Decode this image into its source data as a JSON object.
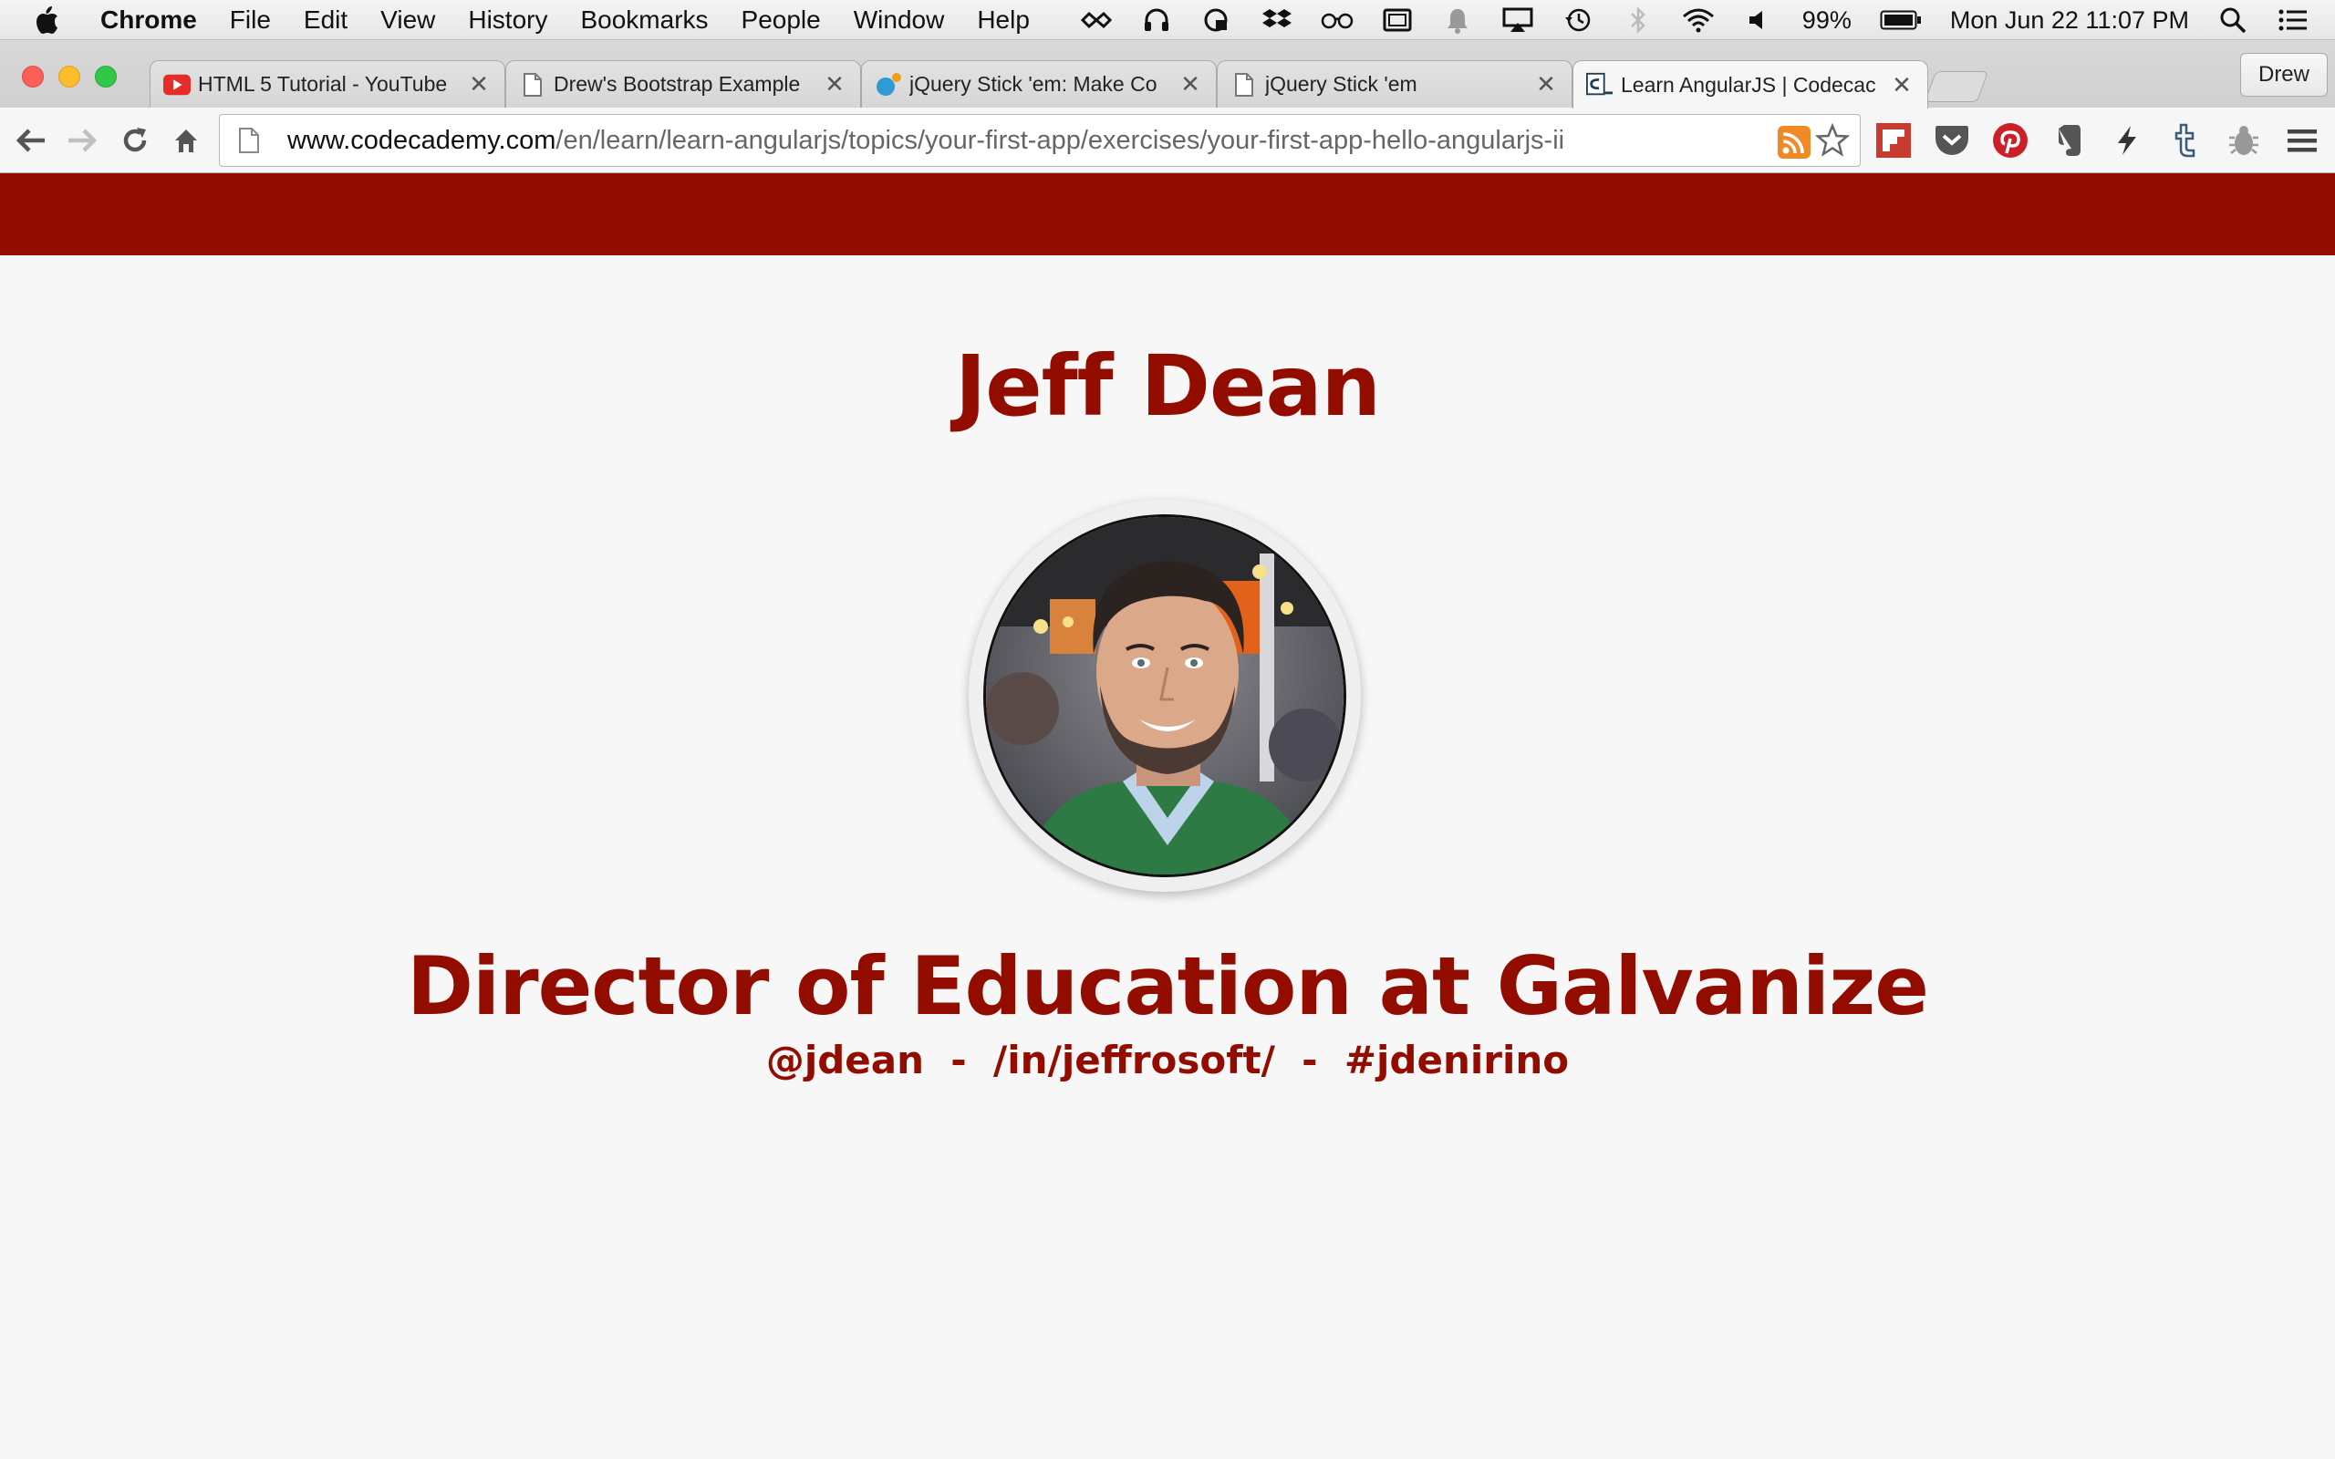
{
  "menubar": {
    "app_name": "Chrome",
    "items": [
      "File",
      "Edit",
      "View",
      "History",
      "Bookmarks",
      "People",
      "Window",
      "Help"
    ],
    "battery": "99%",
    "clock": "Mon Jun 22  11:07 PM",
    "status_icons": [
      "wunderlist-icon",
      "headphones-icon",
      "lastpass-icon",
      "dropbox-icon",
      "glasses-icon",
      "display-icon",
      "notification-bell-icon",
      "airplay-icon",
      "time-machine-icon",
      "bluetooth-icon",
      "wifi-icon",
      "volume-icon",
      "battery-icon",
      "spotlight-search-icon",
      "notification-center-icon"
    ]
  },
  "tabs": [
    {
      "title": "HTML 5 Tutorial - YouTube",
      "icon": "youtube-icon",
      "active": false
    },
    {
      "title": "Drew's Bootstrap Example",
      "icon": "page-icon",
      "active": false
    },
    {
      "title": "jQuery Stick 'em: Make Co",
      "icon": "jquery-icon",
      "active": false
    },
    {
      "title": "jQuery Stick 'em",
      "icon": "page-icon",
      "active": false
    },
    {
      "title": "Learn AngularJS | Codecac",
      "icon": "codecademy-icon",
      "active": true
    }
  ],
  "profile_name": "Drew",
  "omnibox": {
    "url_domain": "www.codecademy.com",
    "url_path": "/en/learn/learn-angularjs/topics/your-first-app/exercises/your-first-app-hello-angularjs-ii"
  },
  "extensions": [
    "flipboard-icon",
    "pocket-icon",
    "pinterest-icon",
    "evernote-icon",
    "lightning-icon",
    "tumblr-icon",
    "bug-icon",
    "menu-icon"
  ],
  "page": {
    "name": "Jeff Dean",
    "job_title": "Director of Education at Galvanize",
    "links": "@jdean  -  /in/jeffrosoft/  -  #jdenirino"
  },
  "colors": {
    "brand": "#920d00",
    "page_bg": "#f7f7f7"
  }
}
